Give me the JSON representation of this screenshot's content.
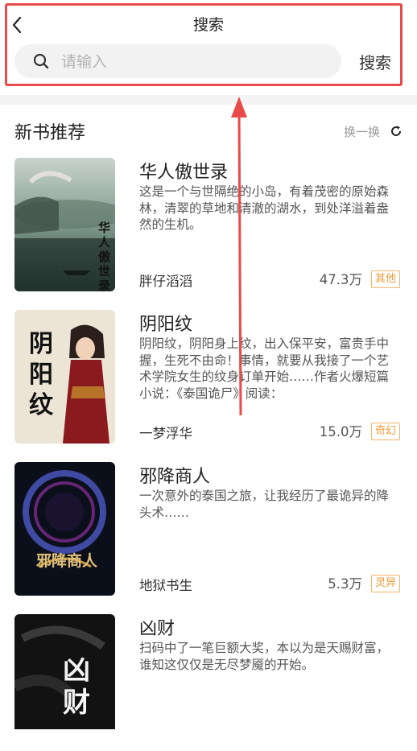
{
  "header": {
    "title": "搜索",
    "search_placeholder": "请输入",
    "search_button": "搜索",
    "back_icon": "chevron-left-icon",
    "search_icon": "search-icon"
  },
  "section": {
    "title": "新书推荐",
    "refresh_label": "换一换",
    "refresh_icon": "refresh-icon"
  },
  "books": [
    {
      "title": "华人傲世录",
      "description": "这是一个与世隔绝的小岛，有着茂密的原始森林，清翠的草地和清澈的湖水，到处洋溢着盎然的生机。",
      "author": "胖仔滔滔",
      "count": "47.3万",
      "tag": "其他",
      "cover_text": "华人傲世录"
    },
    {
      "title": "阴阳纹",
      "description": "阴阳纹，阴阳身上纹，出入保平安，富贵手中握，生死不由命！事情，就要从我接了一个艺术学院女生的纹身订单开始……作者火爆短篇小说：《泰国诡尸》阅读：",
      "author": "一梦浮华",
      "count": "15.0万",
      "tag": "奇幻",
      "cover_text": "阴阳纹"
    },
    {
      "title": "邪降商人",
      "description": "一次意外的泰国之旅，让我经历了最诡异的降头术……",
      "author": "地狱书生",
      "count": "5.3万",
      "tag": "灵异",
      "cover_text": "邪降商人"
    },
    {
      "title": "凶财",
      "description": "扫码中了一笔巨额大奖，本以为是天赐财富，谁知这仅仅是无尽梦魇的开始。",
      "author": "",
      "count": "",
      "tag": "",
      "cover_text": "凶财"
    }
  ],
  "colors": {
    "highlight": "#e94b4b",
    "tag": "#f09a38"
  }
}
